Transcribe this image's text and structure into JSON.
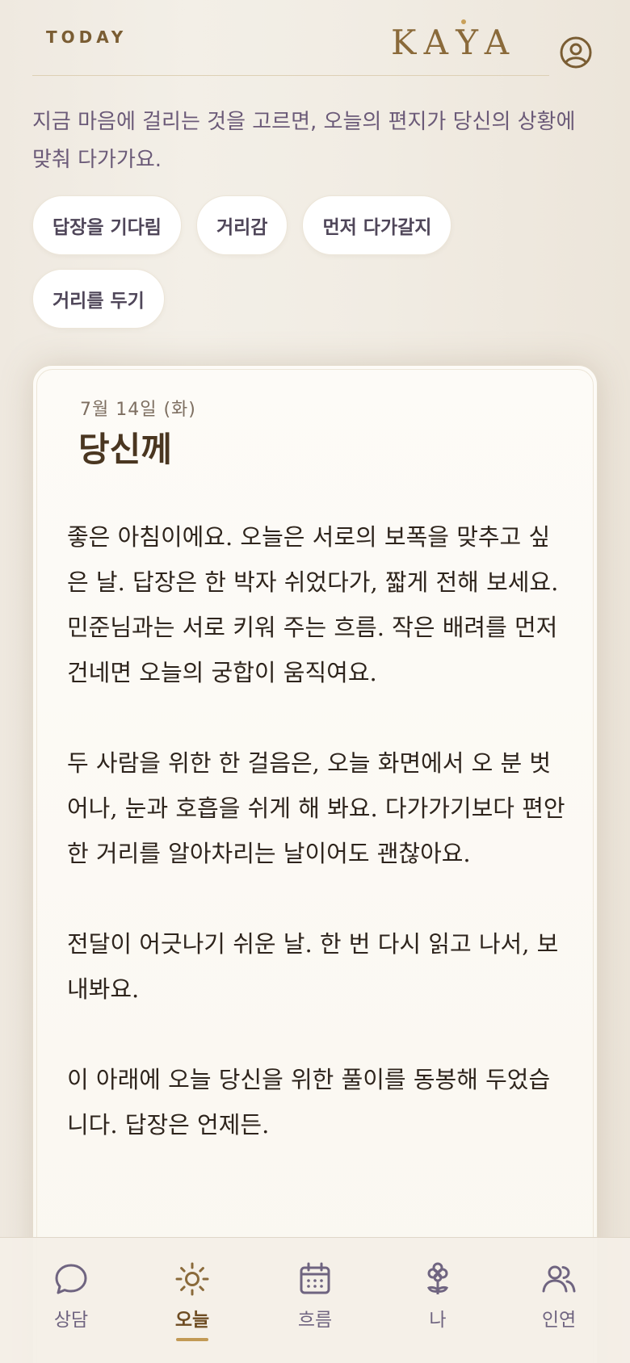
{
  "header": {
    "today_label": "TODAY",
    "brand": "KAYA",
    "profile_icon": "user-circle-icon"
  },
  "intro_text": "지금 마음에 걸리는 것을 고르면, 오늘의 편지가 당신의 상황에 맞춰 다가가요.",
  "chips": [
    {
      "label": "답장을 기다림"
    },
    {
      "label": "거리감"
    },
    {
      "label": "먼저 다가갈지"
    },
    {
      "label": "거리를 두기"
    }
  ],
  "letter": {
    "date": "7월 14일 (화)",
    "salutation": "당신께",
    "paragraphs": [
      "좋은 아침이에요. 오늘은 서로의 보폭을 맞추고 싶은 날. 답장은 한 박자 쉬었다가, 짧게 전해 보세요. 민준님과는 서로 키워 주는 흐름. 작은 배려를 먼저 건네면 오늘의 궁합이 움직여요.",
      "두 사람을 위한 한 걸음은, 오늘 화면에서 오 분 벗어나, 눈과 호흡을 쉬게 해 봐요. 다가가기보다 편안한 거리를 알아차리는 날이어도 괜찮아요.",
      "전달이 어긋나기 쉬운 날. 한 번 다시 읽고 나서, 보내봐요.",
      "이 아래에 오늘 당신을 위한 풀이를 동봉해 두었습니다. 답장은 언제든."
    ]
  },
  "nav": {
    "items": [
      {
        "label": "상담",
        "icon": "chat-bubble-icon",
        "active": false
      },
      {
        "label": "오늘",
        "icon": "sun-icon",
        "active": true
      },
      {
        "label": "흐름",
        "icon": "calendar-icon",
        "active": false
      },
      {
        "label": "나",
        "icon": "flower-icon",
        "active": false
      },
      {
        "label": "인연",
        "icon": "people-icon",
        "active": false
      }
    ]
  },
  "colors": {
    "accent": "#c29a55",
    "brand": "#8a6a3a",
    "nav_inactive": "#6f6480"
  }
}
